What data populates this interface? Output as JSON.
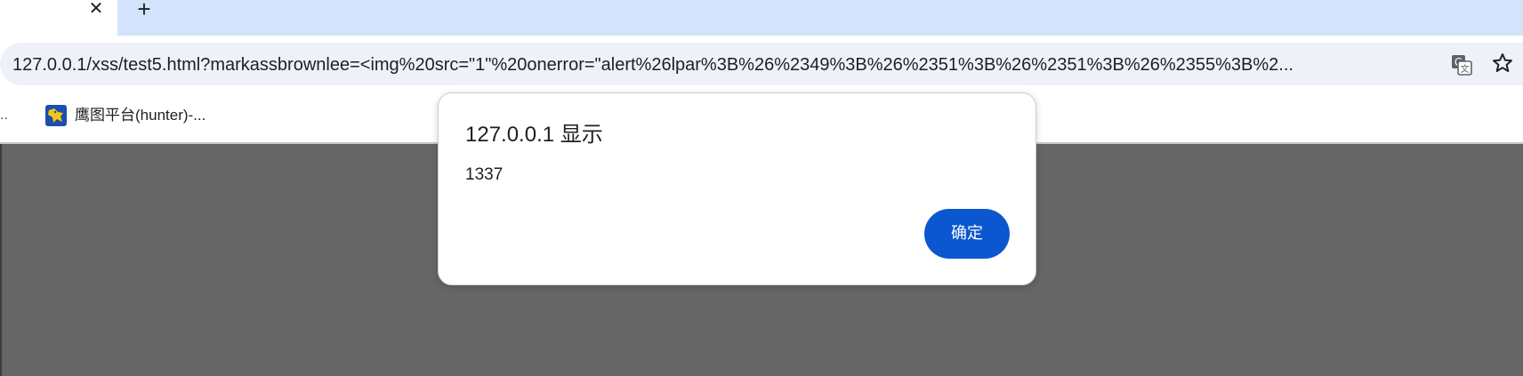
{
  "tabs": {
    "close_glyph": "✕",
    "new_tab_glyph": "+"
  },
  "omnibox": {
    "host": "127.0.0.1",
    "rest": "/xss/test5.html?markassbrownlee=<img%20src=\"1\"%20onerror=\"alert%26lpar%3B%26%2349%3B%26%2351%3B%26%2351%3B%26%2355%3B%2..."
  },
  "bookmarks": {
    "overflow_glyph": "..",
    "items": [
      {
        "label": "鹰图平台(hunter)-...",
        "icon": "hunter-eagle-favicon"
      }
    ]
  },
  "dialog": {
    "title": "127.0.0.1 显示",
    "message": "1337",
    "ok_label": "确定"
  },
  "colors": {
    "tab_strip": "#d3e3fd",
    "omnibox_bg": "#eef2f8",
    "page_overlay": "#666666",
    "primary_button": "#0b57d0"
  }
}
